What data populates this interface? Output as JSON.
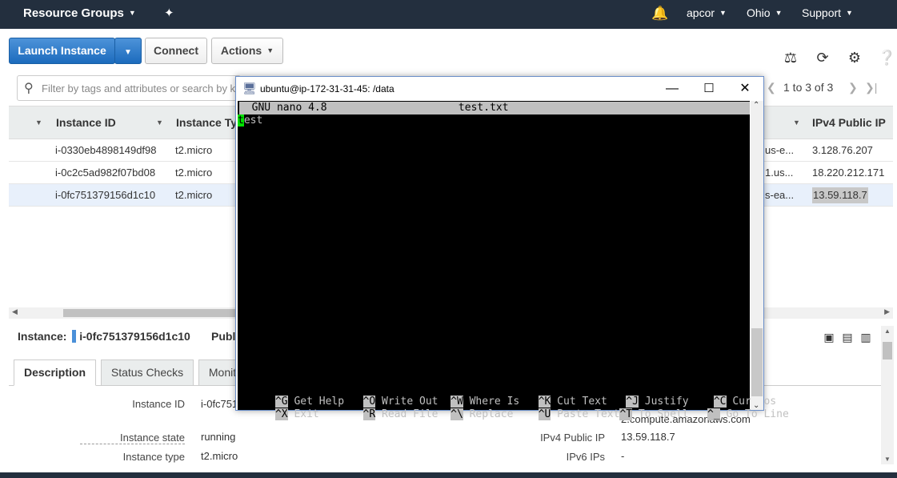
{
  "topbar": {
    "resource_groups": "Resource Groups",
    "user": "apcor",
    "region": "Ohio",
    "support": "Support"
  },
  "toolbar": {
    "launch": "Launch Instance",
    "connect": "Connect",
    "actions": "Actions"
  },
  "search": {
    "placeholder": "Filter by tags and attributes or search by k"
  },
  "pager": {
    "text": "1 to 3 of 3"
  },
  "table": {
    "headers": {
      "instance_id": "Instance ID",
      "instance_type": "Instance Typ",
      "ipv4": "IPv4 Public IP"
    },
    "rows": [
      {
        "id": "i-0330eb4898149df98",
        "type": "t2.micro",
        "dns": "us-e...",
        "ip": "3.128.76.207"
      },
      {
        "id": "i-0c2c5ad982f07bd08",
        "type": "t2.micro",
        "dns": "1.us...",
        "ip": "18.220.212.171"
      },
      {
        "id": "i-0fc751379156d1c10",
        "type": "t2.micro",
        "dns": "s-ea...",
        "ip": "13.59.118.7"
      }
    ]
  },
  "details": {
    "instance_label": "Instance:",
    "instance_id": "i-0fc751379156d1c10",
    "public_label": "Publ",
    "tabs": [
      "Description",
      "Status Checks",
      "Monit"
    ],
    "left": [
      {
        "label": "Instance ID",
        "value": "i-0fc751"
      },
      {
        "label": "Instance state",
        "value": "running"
      },
      {
        "label": "Instance type",
        "value": "t2.micro"
      }
    ],
    "right_dns_tail": "2.compute.amazonaws.com",
    "right": [
      {
        "label": "IPv4 Public IP",
        "value": "13.59.118.7"
      },
      {
        "label": "IPv6 IPs",
        "value": "-"
      }
    ]
  },
  "putty": {
    "title": "ubuntu@ip-172-31-31-45: /data",
    "nano_header": "  GNU nano 4.8                     test.txt",
    "cursor_char": "t",
    "content_rest": "est",
    "shortcuts_row1": [
      {
        "key": "^G",
        "label": " Get Help   "
      },
      {
        "key": "^O",
        "label": " Write Out  "
      },
      {
        "key": "^W",
        "label": " Where Is   "
      },
      {
        "key": "^K",
        "label": " Cut Text   "
      },
      {
        "key": "^J",
        "label": " Justify    "
      },
      {
        "key": "^C",
        "label": " Cur Pos"
      }
    ],
    "shortcuts_row2": [
      {
        "key": "^X",
        "label": " Exit       "
      },
      {
        "key": "^R",
        "label": " Read File  "
      },
      {
        "key": "^\\",
        "label": " Replace    "
      },
      {
        "key": "^U",
        "label": " Paste Text"
      },
      {
        "key": "^T",
        "label": " To Spell   "
      },
      {
        "key": "^_",
        "label": " Go To Line"
      }
    ]
  }
}
